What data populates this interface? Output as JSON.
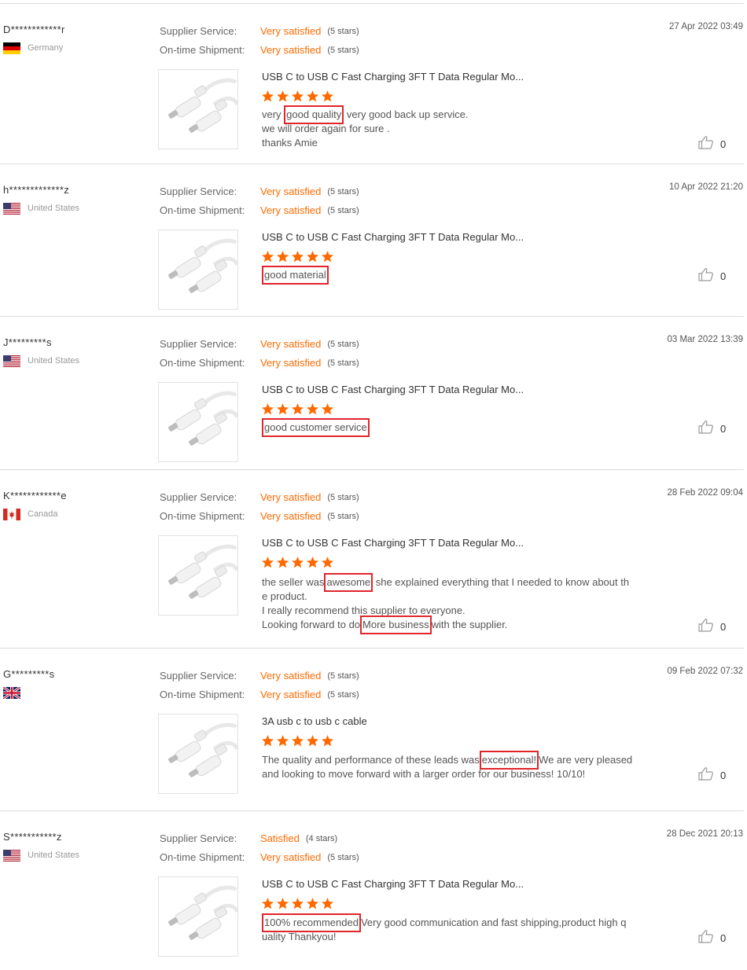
{
  "labels": {
    "supplier_service": "Supplier Service:",
    "ontime_shipment": "On-time Shipment:"
  },
  "colors": {
    "accent": "#ff6a00",
    "highlight": "#e0252b"
  },
  "reviews": [
    {
      "reviewer": "D************r",
      "country": "Germany",
      "flag": "germany-flag-icon",
      "supplier_service": {
        "value": "Very satisfied",
        "stars_text": "(5 stars)"
      },
      "ontime_shipment": {
        "value": "Very satisfied",
        "stars_text": "(5 stars)"
      },
      "date": "27 Apr 2022 03:49",
      "product_title": "USB C to USB C Fast Charging 3FT T Data Regular Mo...",
      "rating": 5,
      "comment": [
        "very ",
        "[good quality]",
        " very good back up service.",
        "\nwe will order again for sure .",
        "\nthanks Amie"
      ],
      "likes": "0"
    },
    {
      "reviewer": "h*************z",
      "country": "United States",
      "flag": "usa-flag-icon",
      "supplier_service": {
        "value": "Very satisfied",
        "stars_text": "(5 stars)"
      },
      "ontime_shipment": {
        "value": "Very satisfied",
        "stars_text": "(5 stars)"
      },
      "date": "10 Apr 2022 21:20",
      "product_title": "USB C to USB C Fast Charging 3FT T Data Regular Mo...",
      "rating": 5,
      "comment": [
        "[good material]"
      ],
      "likes": "0"
    },
    {
      "reviewer": "J*********s",
      "country": "United States",
      "flag": "usa-flag-icon",
      "supplier_service": {
        "value": "Very satisfied",
        "stars_text": "(5 stars)"
      },
      "ontime_shipment": {
        "value": "Very satisfied",
        "stars_text": "(5 stars)"
      },
      "date": "03 Mar 2022 13:39",
      "product_title": "USB C to USB C Fast Charging 3FT T Data Regular Mo...",
      "rating": 5,
      "comment": [
        "[good customer service]"
      ],
      "likes": "0"
    },
    {
      "reviewer": "K************e",
      "country": "Canada",
      "flag": "canada-flag-icon",
      "supplier_service": {
        "value": "Very satisfied",
        "stars_text": "(5 stars)"
      },
      "ontime_shipment": {
        "value": "Very satisfied",
        "stars_text": "(5 stars)"
      },
      "date": "28 Feb 2022 09:04",
      "product_title": "USB C to USB C Fast Charging 3FT T Data Regular Mo...",
      "rating": 5,
      "comment": [
        "the seller was",
        "[awesome]",
        " she explained everything that I needed to know about th",
        "\ne product.",
        "\nI really recommend this supplier to everyone.",
        "\nLooking forward to do",
        "[More business]",
        "with the supplier."
      ],
      "likes": "0"
    },
    {
      "reviewer": "G*********s",
      "country": "",
      "flag": "uk-flag-icon",
      "supplier_service": {
        "value": "Very satisfied",
        "stars_text": "(5 stars)"
      },
      "ontime_shipment": {
        "value": "Very satisfied",
        "stars_text": "(5 stars)"
      },
      "date": "09 Feb 2022 07:32",
      "product_title": "3A usb c to usb c cable",
      "rating": 5,
      "comment": [
        "The quality and performance of these leads was",
        "[exceptional!]",
        "We are very pleased",
        "\nand looking to move forward with a larger order for our business! 10/10!"
      ],
      "likes": "0"
    },
    {
      "reviewer": "S***********z",
      "country": "United States",
      "flag": "usa-flag-icon",
      "supplier_service": {
        "value": "Satisfied",
        "stars_text": "(4 stars)"
      },
      "ontime_shipment": {
        "value": "Very satisfied",
        "stars_text": "(5 stars)"
      },
      "date": "28 Dec 2021 20:13",
      "product_title": "USB C to USB C Fast Charging 3FT T Data Regular Mo...",
      "rating": 5,
      "comment": [
        "[100% recommended]",
        "Very good communication and fast shipping,product high q",
        "\nuality Thankyou!"
      ],
      "likes": "0"
    }
  ]
}
